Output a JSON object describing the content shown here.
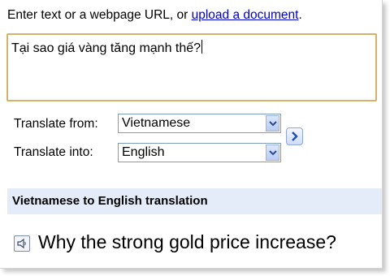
{
  "intro": {
    "text": "Enter text or a webpage URL, or ",
    "link": "upload a document",
    "suffix": "."
  },
  "source": {
    "value": "Tại sao giá vàng tăng mạnh thế?"
  },
  "translate_from": {
    "label": "Translate from:",
    "selected": "Vietnamese"
  },
  "translate_into": {
    "label": "Translate into:",
    "selected": "English"
  },
  "swap_button": {
    "icon": "chevron-right-icon"
  },
  "result": {
    "header": "Vietnamese to English translation",
    "text": "Why the strong gold price increase?",
    "listen_icon": "speaker-icon"
  },
  "colors": {
    "link": "#0000cc",
    "input_border": "#d7b16a",
    "header_bg": "#e5ecf9"
  }
}
